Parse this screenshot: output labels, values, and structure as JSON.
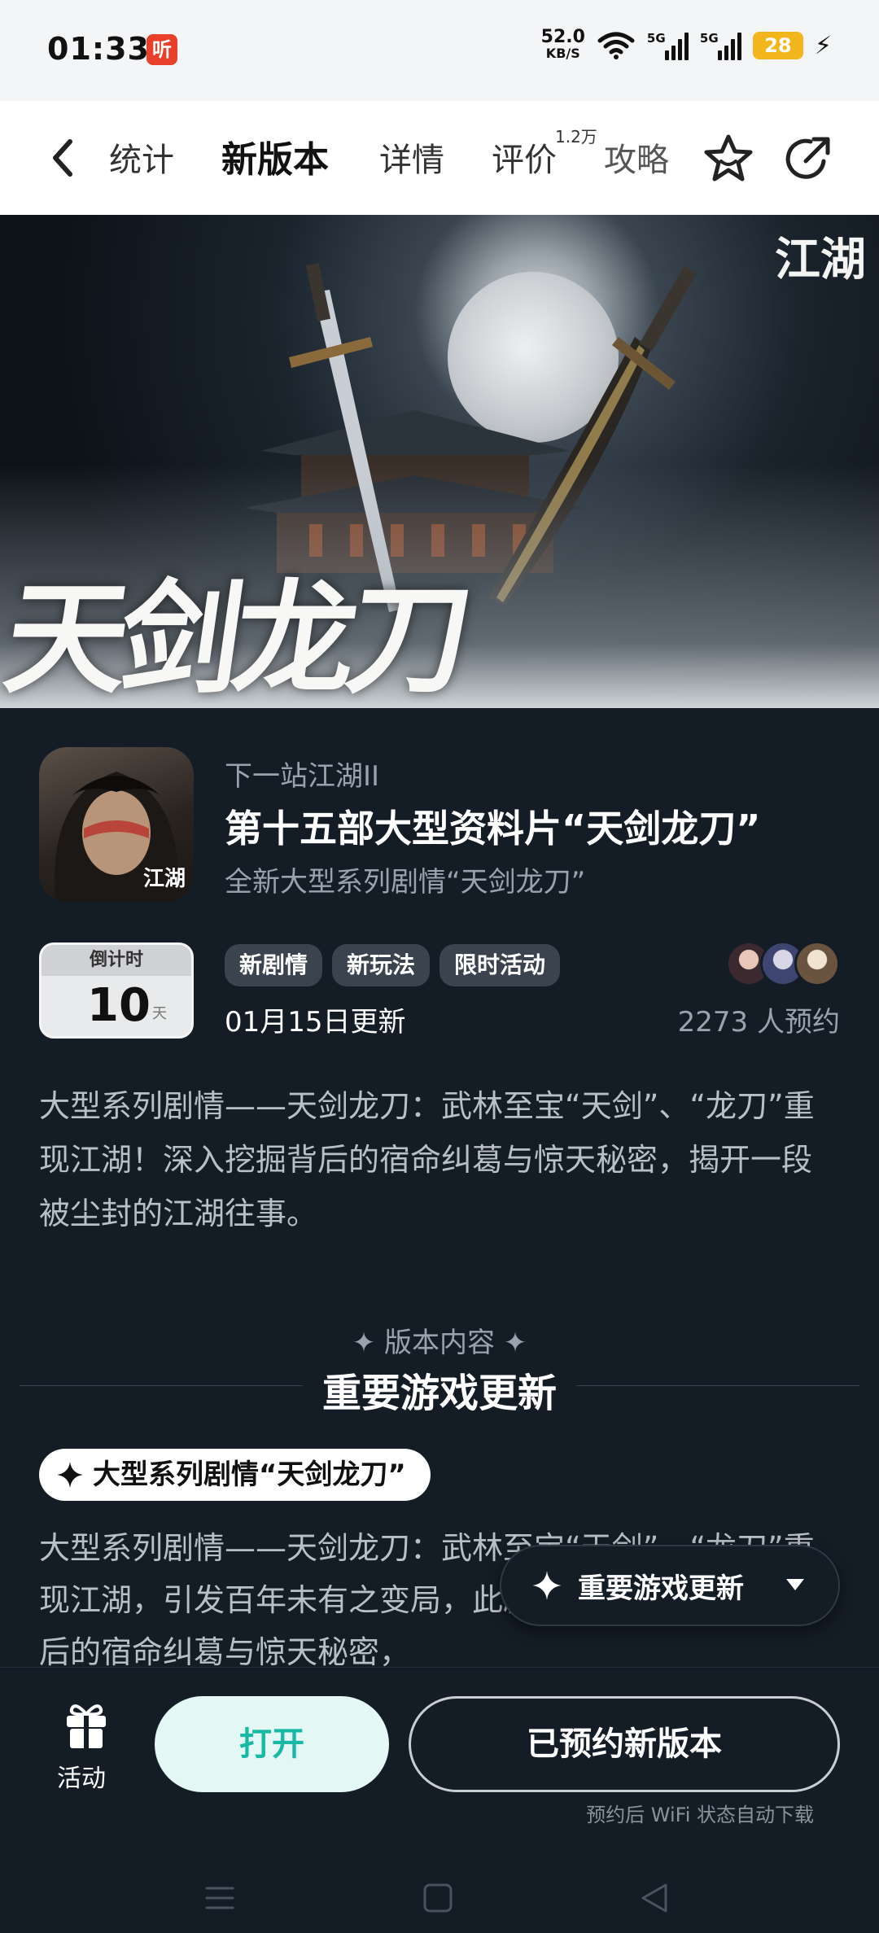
{
  "status_bar": {
    "time": "01:33",
    "app_icon": "听",
    "net_speed_value": "52.0",
    "net_speed_unit": "KB/S",
    "signal1_tag": "5G",
    "signal2_tag": "5G",
    "battery": "28",
    "charging_icon": "⚡"
  },
  "nav": {
    "tabs": [
      {
        "label": "统计"
      },
      {
        "label": "新版本"
      },
      {
        "label": "详情"
      },
      {
        "label": "评价"
      },
      {
        "label": "攻略"
      }
    ],
    "review_badge": "1.2万",
    "active_color": "#22c8b4"
  },
  "banner": {
    "title": "天剑龙刀",
    "logo": "江湖"
  },
  "game": {
    "icon_logo": "江湖",
    "sub_title": "下一站江湖II",
    "title": "第十五部大型资料片“天剑龙刀”",
    "short_desc": "全新大型系列剧情“天剑龙刀”"
  },
  "countdown": {
    "label": "倒计时",
    "number": "10",
    "unit": "天"
  },
  "tags": [
    "新剧情",
    "新玩法",
    "限时活动"
  ],
  "update_date": "01月15日更新",
  "reserve_count": "2273 人预约",
  "intro": "大型系列剧情——天剑龙刀：武林至宝“天剑”、“龙刀”重现江湖！深入挖掘背后的宿命纠葛与惊天秘密，揭开一段被尘封的江湖往事。",
  "section": {
    "small": "✦ 版本内容 ✦",
    "big": "重要游戏更新"
  },
  "feature": {
    "pill": "大型系列剧情“天剑龙刀”",
    "text": "大型系列剧情——天剑龙刀：武林至宝“天剑”、“龙刀”重现江湖，引发百年未有之变局，此剧情将深入挖掘双兵背后的宿命纠葛与惊天秘密，"
  },
  "float_pill": {
    "label": "重要游戏更新"
  },
  "bottom": {
    "activity_label": "活动",
    "open_label": "打开",
    "reserved_label": "已预约新版本",
    "hint": "预约后 WiFi 状态自动下载"
  }
}
